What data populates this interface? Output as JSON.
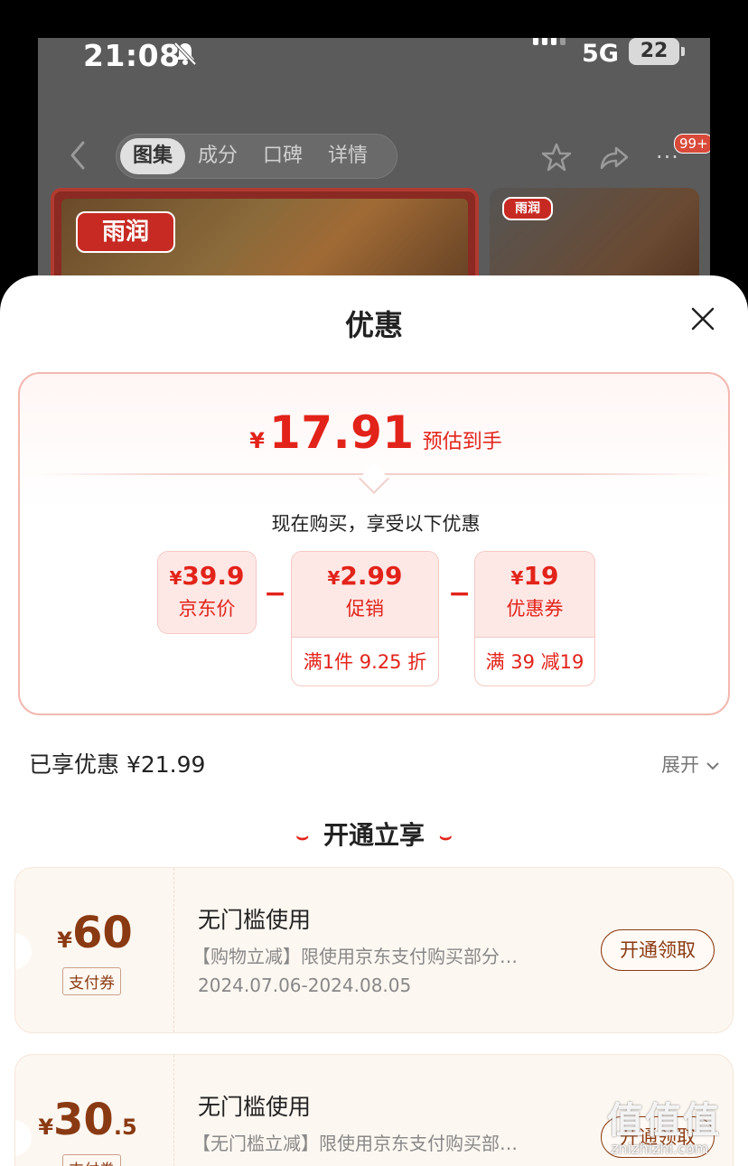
{
  "status_bar": {
    "time": "21:08",
    "network": "5G",
    "battery": "22"
  },
  "nav": {
    "tabs": [
      {
        "label": "图集",
        "active": true
      },
      {
        "label": "成分",
        "active": false
      },
      {
        "label": "口碑",
        "active": false
      },
      {
        "label": "详情",
        "active": false
      }
    ],
    "cart_badge": "99+",
    "more": "···"
  },
  "product_images": {
    "brand_logo_text": "雨润"
  },
  "sheet": {
    "title": "优惠",
    "estimate": {
      "currency": "¥",
      "amount": "17.91",
      "label": "预估到手"
    },
    "subhead": "现在购买，享受以下优惠",
    "breakdown": [
      {
        "currency": "¥",
        "value": "39.9",
        "caption": "京东价",
        "detail": ""
      },
      {
        "currency": "¥",
        "value": "2.99",
        "caption": "促销",
        "detail": "满1件 9.25 折"
      },
      {
        "currency": "¥",
        "value": "19",
        "caption": "优惠券",
        "detail": "满 39 减19"
      }
    ],
    "operator": "−",
    "enjoyed": "已享优惠 ¥21.99",
    "expand_label": "展开",
    "section_title": "开通立享",
    "coupons": [
      {
        "currency": "¥",
        "amount_int": "60",
        "amount_dec": "",
        "tag": "支付券",
        "title": "无门槛使用",
        "desc": "【购物立减】限使用京东支付购买部分…",
        "period": "2024.07.06-2024.08.05",
        "button": "开通领取"
      },
      {
        "currency": "¥",
        "amount_int": "30",
        "amount_dec": ".5",
        "tag": "支付券",
        "title": "无门槛使用",
        "desc": "【无门槛立减】限使用京东支付购买部…",
        "period": "",
        "button": "开通领取"
      }
    ]
  },
  "watermark": {
    "big": "值值值",
    "small": "znizhizhi.com"
  },
  "colors": {
    "accent_red": "#e2231a",
    "coupon_brown": "#8a3a12"
  }
}
